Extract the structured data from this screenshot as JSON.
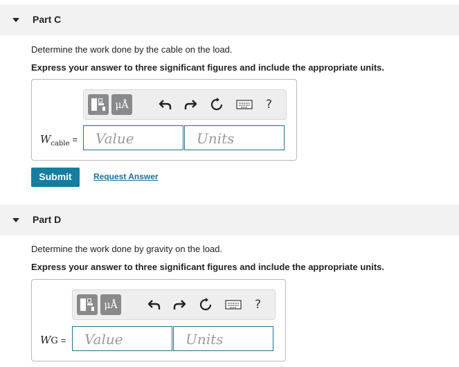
{
  "part_c": {
    "header": "Part C",
    "question": "Determine the work done by the cable on the load.",
    "instruction": "Express your answer to three significant figures and include the appropriate units.",
    "var_symbol": "W",
    "var_subscript": "cable",
    "equals": "=",
    "value_placeholder": "Value",
    "units_placeholder": "Units",
    "mu_label": "μÅ",
    "help_label": "?",
    "submit_label": "Submit",
    "request_label": "Request Answer"
  },
  "part_d": {
    "header": "Part D",
    "question": "Determine the work done by gravity on the load.",
    "instruction": "Express your answer to three significant figures and include the appropriate units.",
    "var_symbol": "W",
    "var_subscript": "G",
    "equals": "=",
    "value_placeholder": "Value",
    "units_placeholder": "Units",
    "mu_label": "μÅ",
    "help_label": "?"
  },
  "colors": {
    "accent": "#157ea0",
    "link": "#1a6f96",
    "input_border": "#1f6f8b",
    "header_bg": "#f2f2f2"
  },
  "icons": [
    "caret-down-icon",
    "templates-icon",
    "undo-icon",
    "redo-icon",
    "reset-icon",
    "keyboard-icon",
    "help-icon"
  ]
}
